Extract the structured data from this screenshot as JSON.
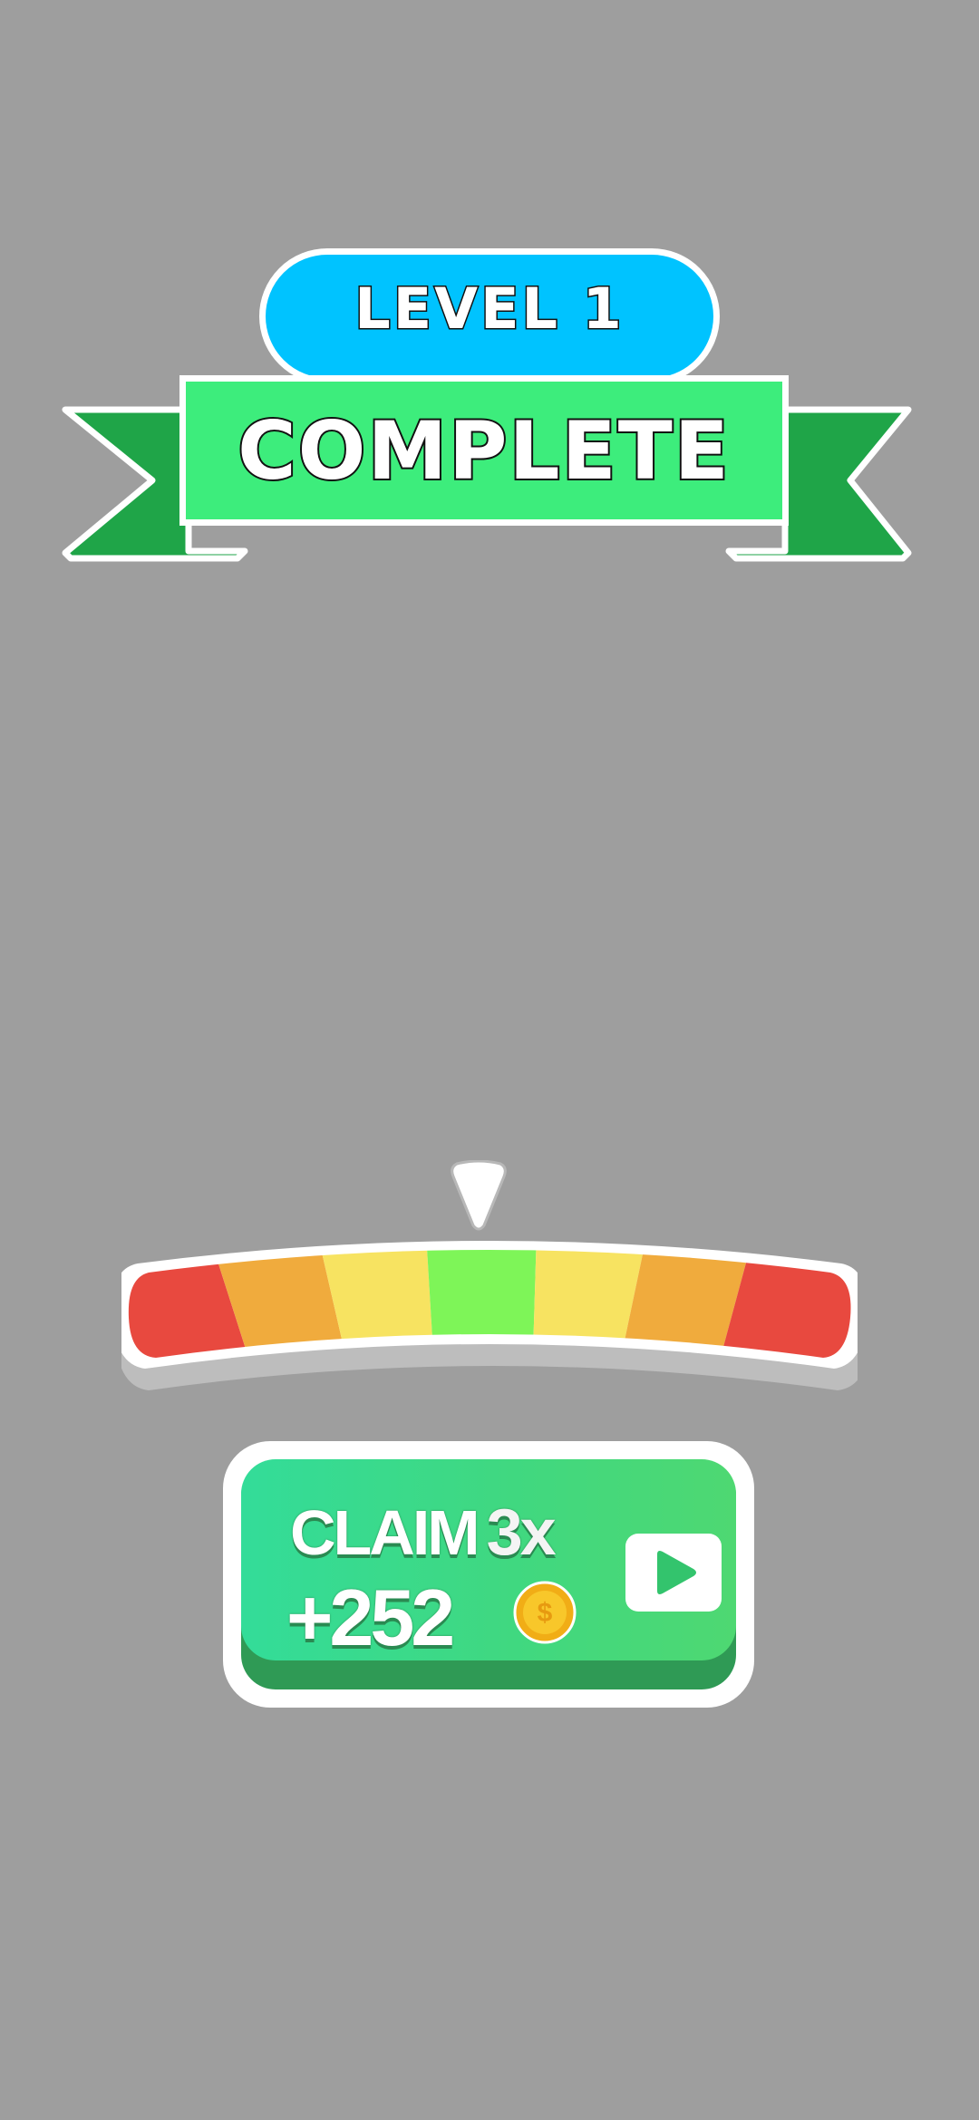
{
  "banner": {
    "level_label": "LEVEL 1",
    "title": "COMPLETE"
  },
  "multiplier_bar": {
    "segments": [
      {
        "color": "#e8493f"
      },
      {
        "color": "#f0ab3d"
      },
      {
        "color": "#f7e361"
      },
      {
        "color": "#7ef558"
      },
      {
        "color": "#f7e361"
      },
      {
        "color": "#f0ab3d"
      },
      {
        "color": "#e8493f"
      }
    ],
    "pointer_icon": "pointer-triangle-icon"
  },
  "claim_button": {
    "label": "CLAIM",
    "multiplier": "3x",
    "amount": "+252",
    "coin_icon": "coin-icon",
    "action_icon": "play-video-icon"
  },
  "colors": {
    "background": "#9e9e9e",
    "level_pill": "#00c3ff",
    "title_plate": "#3ded7c",
    "ribbon_tail": "#1fa548",
    "claim_button": "#40d880"
  }
}
